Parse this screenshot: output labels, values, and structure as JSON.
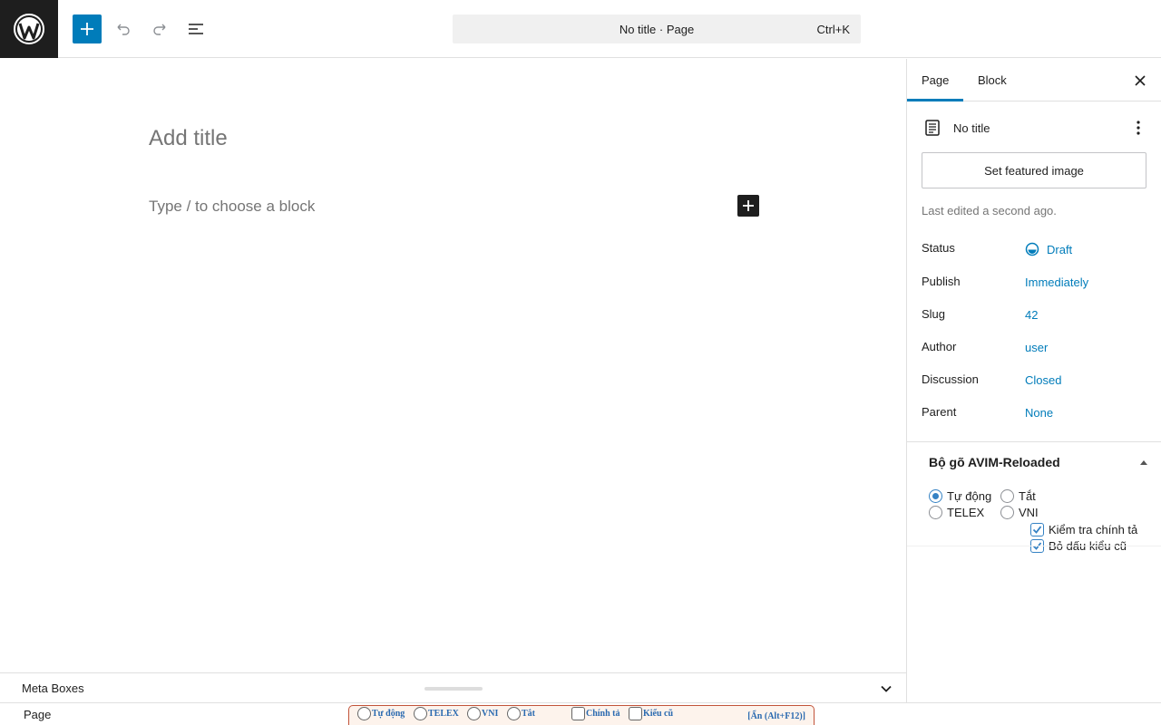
{
  "colors": {
    "accent": "#007cba",
    "dark": "#1e1e1e",
    "muted": "#757575",
    "avim_border": "#c2543a",
    "avim_text": "#2a6ab0"
  },
  "toolbar": {
    "logo_icon": "wordpress-logo-icon",
    "add_icon": "plus-icon",
    "undo_icon": "undo-icon",
    "redo_icon": "redo-icon",
    "list_view_icon": "list-view-icon",
    "command_title": "No title · Page",
    "command_shortcut": "Ctrl+K"
  },
  "editor": {
    "title_placeholder": "Add title",
    "block_placeholder": "Type / to choose a block"
  },
  "sidebar": {
    "tabs": [
      {
        "label": "Page",
        "active": true
      },
      {
        "label": "Block",
        "active": false
      }
    ],
    "close_icon": "close-icon",
    "document_title": "No title",
    "featured_image_label": "Set featured image",
    "last_edited": "Last edited a second ago.",
    "meta": [
      {
        "label": "Status",
        "value": "Draft"
      },
      {
        "label": "Publish",
        "value": "Immediately"
      },
      {
        "label": "Slug",
        "value": "42"
      },
      {
        "label": "Author",
        "value": "user"
      },
      {
        "label": "Discussion",
        "value": "Closed"
      },
      {
        "label": "Parent",
        "value": "None"
      }
    ],
    "avim_panel": {
      "title": "Bộ gõ AVIM-Reloaded",
      "radios": [
        {
          "label": "Tự động",
          "checked": true
        },
        {
          "label": "Tắt",
          "checked": false
        },
        {
          "label": "TELEX",
          "checked": false
        },
        {
          "label": "VNI",
          "checked": false
        }
      ],
      "checkboxes": [
        {
          "label": "Kiểm tra chính tả",
          "checked": true
        },
        {
          "label": "Bỏ dấu kiểu cũ",
          "checked": true
        }
      ]
    }
  },
  "metabox": {
    "label": "Meta Boxes"
  },
  "footer": {
    "breadcrumb": "Page",
    "avim_bar": {
      "radios": [
        "Tự động",
        "TELEX",
        "VNI",
        "Tắt"
      ],
      "checkboxes": [
        "Chính tả",
        "Kiểu cũ"
      ],
      "hide_label": "[Ẩn (Alt+F12)]"
    }
  }
}
